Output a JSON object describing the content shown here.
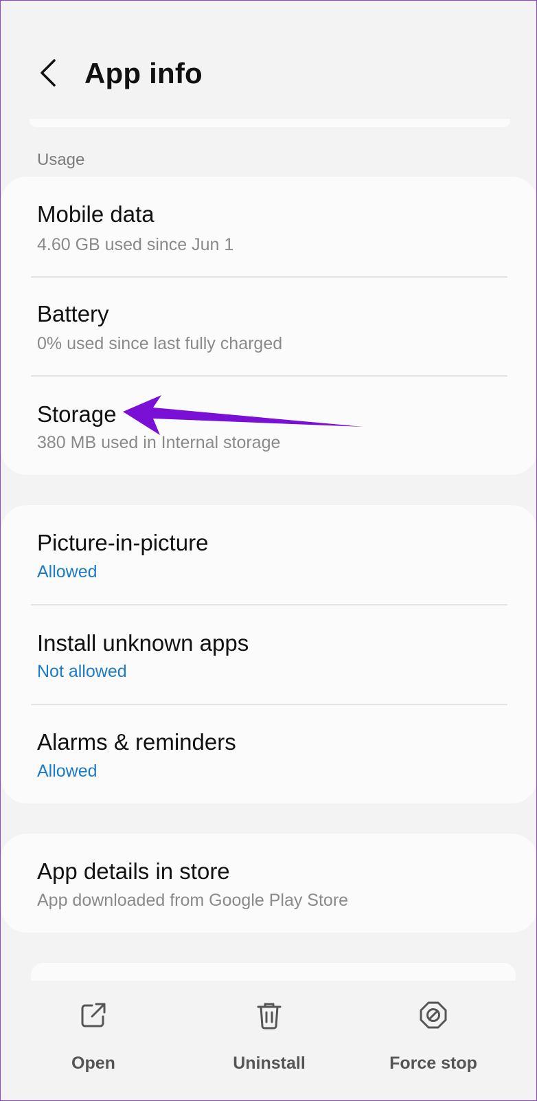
{
  "header": {
    "title": "App info"
  },
  "usage": {
    "label": "Usage",
    "items": [
      {
        "title": "Mobile data",
        "subtitle": "4.60 GB used since Jun 1"
      },
      {
        "title": "Battery",
        "subtitle": "0% used since last fully charged"
      },
      {
        "title": "Storage",
        "subtitle": "380 MB used in Internal storage"
      }
    ]
  },
  "permissions": {
    "items": [
      {
        "title": "Picture-in-picture",
        "subtitle": "Allowed"
      },
      {
        "title": "Install unknown apps",
        "subtitle": "Not allowed"
      },
      {
        "title": "Alarms & reminders",
        "subtitle": "Allowed"
      }
    ]
  },
  "store": {
    "title": "App details in store",
    "subtitle": "App downloaded from Google Play Store"
  },
  "actions": {
    "open": "Open",
    "uninstall": "Uninstall",
    "force_stop": "Force stop"
  },
  "colors": {
    "accent_blue": "#1e7bc9",
    "annotation_arrow": "#7a0fd6",
    "background": "#f3f3f3",
    "card": "#fbfbfb"
  },
  "icons": [
    "back-arrow-icon",
    "open-external-icon",
    "trash-icon",
    "stop-icon"
  ]
}
